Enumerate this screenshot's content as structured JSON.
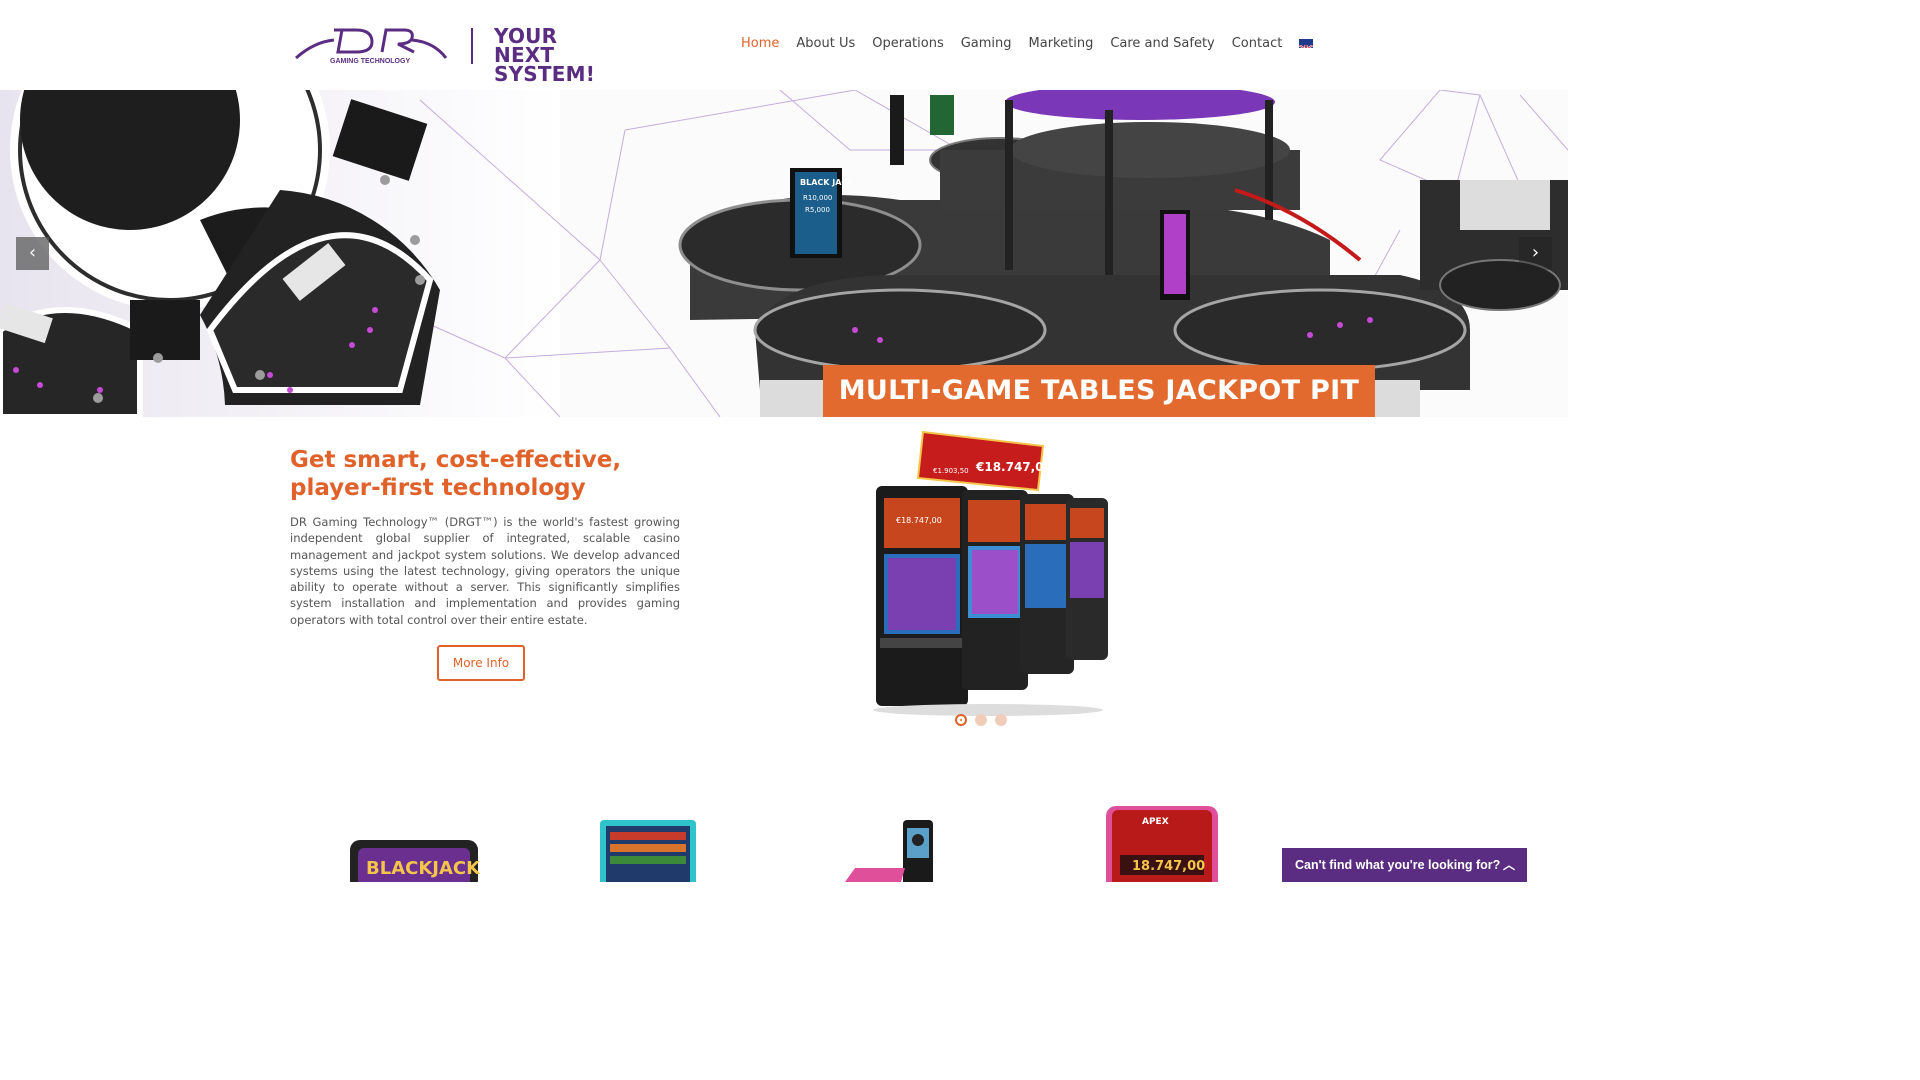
{
  "header": {
    "logo_text": "DR",
    "logo_subtext": "GAMING TECHNOLOGY",
    "tagline_line1": "YOUR NEXT",
    "tagline_line2": "SYSTEM!",
    "nav": [
      {
        "label": "Home",
        "active": true
      },
      {
        "label": "About Us",
        "active": false
      },
      {
        "label": "Operations",
        "active": false
      },
      {
        "label": "Gaming",
        "active": false
      },
      {
        "label": "Marketing",
        "active": false
      },
      {
        "label": "Care and Safety",
        "active": false
      },
      {
        "label": "Contact",
        "active": false
      }
    ],
    "language_flag": "uk-flag-icon"
  },
  "hero": {
    "banner_text": "MULTI-GAME TABLES JACKPOT PIT",
    "prev_arrow": "‹",
    "next_arrow": "›",
    "screen_labels": [
      "BLACK JACK",
      "R10,000",
      "R5,000"
    ]
  },
  "intro": {
    "title": "Get smart, cost-effective, player-first technology",
    "body": "DR Gaming Technology™ (DRGT™) is the world's fastest growing independent global supplier of integrated, scalable casino management and jackpot system solutions. We develop advanced systems using the latest technology, giving operators the unique ability to operate without a server. This significantly simplifies system installation and implementation and provides gaming operators with total control over their entire estate.",
    "button_label": "More Info",
    "jackpot_amount": "€18.747,00",
    "jackpot_small": "€1.903,50",
    "carousel": {
      "count": 3,
      "active": 0
    }
  },
  "products": {
    "blackjack_label": "BLACKJACK",
    "apex_label": "APEX",
    "apex_amount": "18.747,00"
  },
  "chat": {
    "label": "Can't find what you're looking for?",
    "icon": "chevron-up-icon"
  },
  "colors": {
    "accent": "#e0622a",
    "brand_purple": "#5a2d82"
  }
}
